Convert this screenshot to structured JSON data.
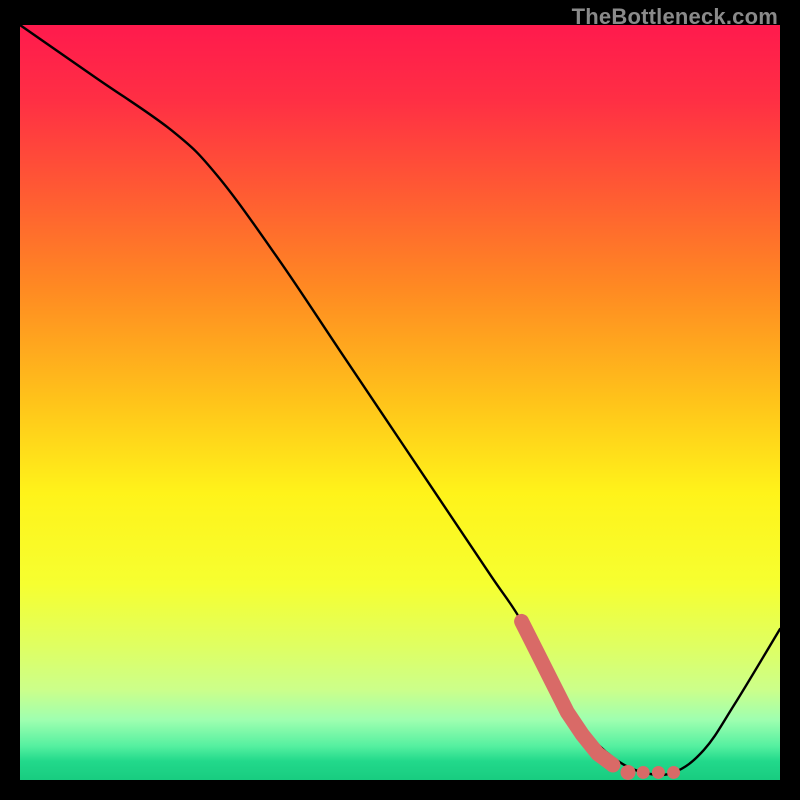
{
  "watermark": "TheBottleneck.com",
  "colors": {
    "gradient_stops": [
      {
        "offset": 0.0,
        "color": "#ff1a4d"
      },
      {
        "offset": 0.1,
        "color": "#ff2f44"
      },
      {
        "offset": 0.22,
        "color": "#ff5a33"
      },
      {
        "offset": 0.35,
        "color": "#ff8a22"
      },
      {
        "offset": 0.5,
        "color": "#ffc41a"
      },
      {
        "offset": 0.62,
        "color": "#fff31a"
      },
      {
        "offset": 0.74,
        "color": "#f6ff30"
      },
      {
        "offset": 0.82,
        "color": "#e0ff60"
      },
      {
        "offset": 0.88,
        "color": "#ccff8a"
      },
      {
        "offset": 0.92,
        "color": "#9fffb0"
      },
      {
        "offset": 0.955,
        "color": "#55f0a0"
      },
      {
        "offset": 0.975,
        "color": "#22d98b"
      },
      {
        "offset": 1.0,
        "color": "#18cc80"
      }
    ],
    "curve": "#000000",
    "marker": "#d96a67",
    "frame": "#000000"
  },
  "chart_data": {
    "type": "line",
    "title": "",
    "xlabel": "",
    "ylabel": "",
    "xlim": [
      0,
      100
    ],
    "ylim": [
      0,
      100
    ],
    "grid": false,
    "legend": null,
    "series": [
      {
        "name": "bottleneck-curve",
        "x": [
          0,
          10,
          20,
          26,
          34,
          42,
          50,
          56,
          62,
          66,
          70,
          74,
          78,
          82,
          86,
          90,
          94,
          100
        ],
        "y": [
          100,
          93,
          86,
          80,
          69,
          57,
          45,
          36,
          27,
          21,
          13,
          7,
          3,
          1,
          1,
          4,
          10,
          20
        ]
      }
    ],
    "markers": {
      "name": "highlight",
      "points": [
        {
          "x": 66,
          "y": 21
        },
        {
          "x": 68,
          "y": 17
        },
        {
          "x": 70,
          "y": 13
        },
        {
          "x": 72,
          "y": 9
        },
        {
          "x": 74,
          "y": 6
        },
        {
          "x": 76,
          "y": 3.5
        },
        {
          "x": 78,
          "y": 2
        },
        {
          "x": 80,
          "y": 1
        },
        {
          "x": 82,
          "y": 1
        },
        {
          "x": 84,
          "y": 1
        },
        {
          "x": 86,
          "y": 1
        }
      ]
    }
  }
}
